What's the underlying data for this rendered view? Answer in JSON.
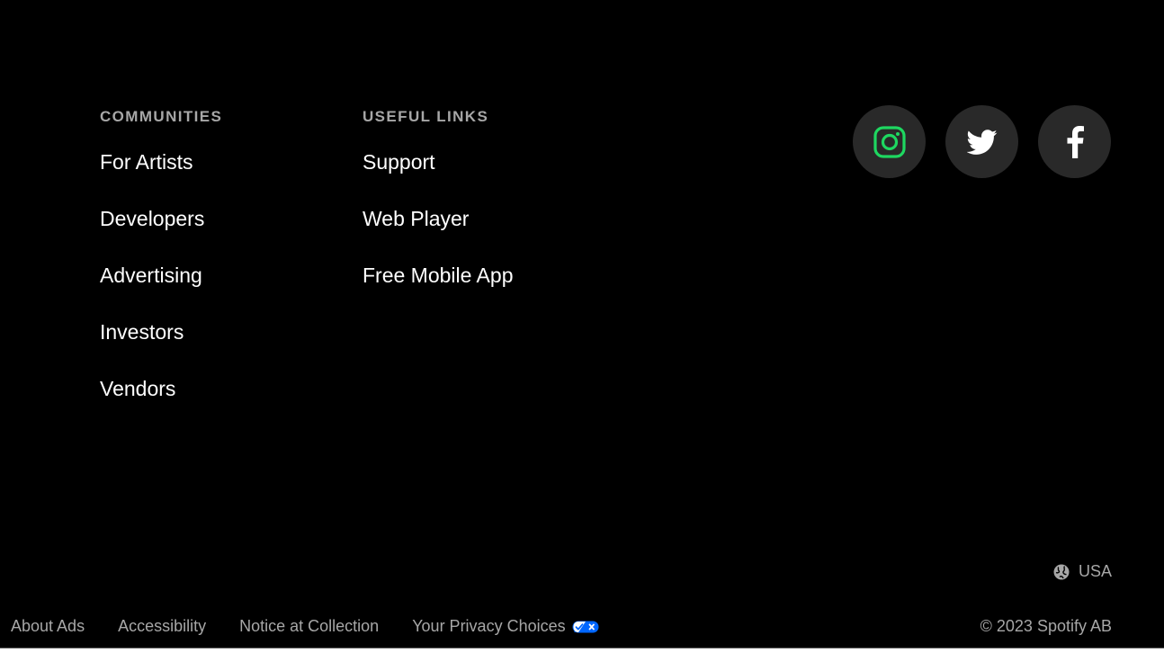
{
  "communities": {
    "heading": "COMMUNITIES",
    "links": [
      "For Artists",
      "Developers",
      "Advertising",
      "Investors",
      "Vendors"
    ]
  },
  "useful_links": {
    "heading": "USEFUL LINKS",
    "links": [
      "Support",
      "Web Player",
      "Free Mobile App"
    ]
  },
  "social": {
    "icons": [
      "instagram-icon",
      "twitter-icon",
      "facebook-icon"
    ],
    "instagram_color": "#1ed760",
    "icon_color": "#ffffff",
    "button_bg": "#292929"
  },
  "region": {
    "icon": "globe-icon",
    "label": "USA"
  },
  "legal": {
    "links": [
      "About Ads",
      "Accessibility",
      "Notice at Collection",
      "Your Privacy Choices"
    ],
    "privacy_badge_icon": "privacy-toggle-icon",
    "privacy_badge_color": "#0066ff"
  },
  "copyright": "© 2023 Spotify AB",
  "colors": {
    "background": "#000000",
    "text_primary": "#ffffff",
    "text_secondary": "#a7a7a7"
  }
}
